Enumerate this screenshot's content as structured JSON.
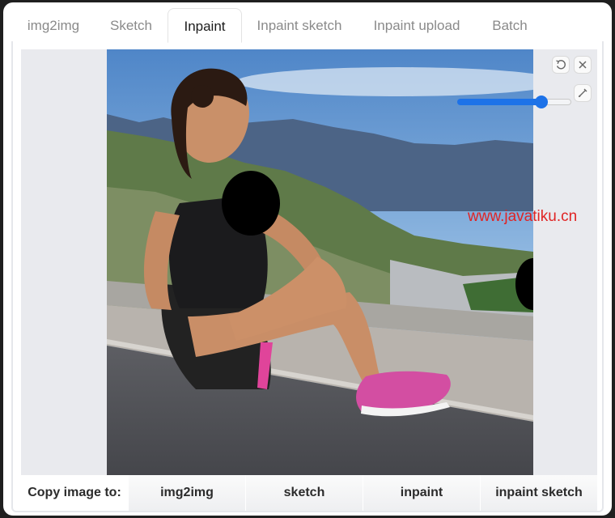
{
  "tabs": [
    {
      "label": "img2img",
      "active": false
    },
    {
      "label": "Sketch",
      "active": false
    },
    {
      "label": "Inpaint",
      "active": true
    },
    {
      "label": "Inpaint sketch",
      "active": false
    },
    {
      "label": "Inpaint upload",
      "active": false
    },
    {
      "label": "Batch",
      "active": false
    }
  ],
  "canvas": {
    "controls": [
      "undo-icon",
      "close-icon",
      "brush-icon"
    ],
    "brush_size_level": 0.75,
    "accent_color": "#1d72e8"
  },
  "watermark": "www.javatiku.cn",
  "copy_bar": {
    "label": "Copy image to:",
    "buttons": [
      "img2img",
      "sketch",
      "inpaint",
      "inpaint sketch"
    ]
  }
}
